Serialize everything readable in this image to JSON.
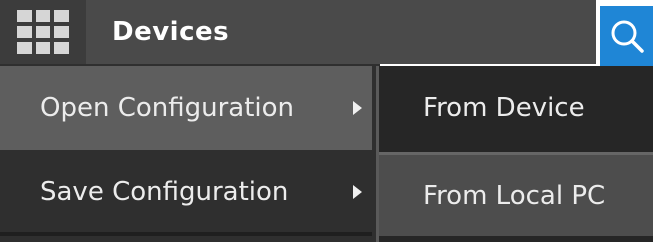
{
  "header": {
    "title": "Devices",
    "apps_icon": "grid-icon",
    "search_icon": "search-icon"
  },
  "menu": {
    "items": [
      {
        "label": "Open Configuration",
        "has_submenu": true,
        "state": "hover"
      },
      {
        "label": "Save Configuration",
        "has_submenu": true,
        "state": "normal"
      }
    ]
  },
  "submenu": {
    "items": [
      {
        "label": "From Device",
        "state": "normal"
      },
      {
        "label": "From Local PC",
        "state": "hover"
      }
    ]
  },
  "colors": {
    "accent": "#1f86d6",
    "menu_bg": "#2f2f2f",
    "menu_hover": "#5e5e5e",
    "submenu_bg": "#262626",
    "submenu_hover": "#4d4d4d"
  }
}
